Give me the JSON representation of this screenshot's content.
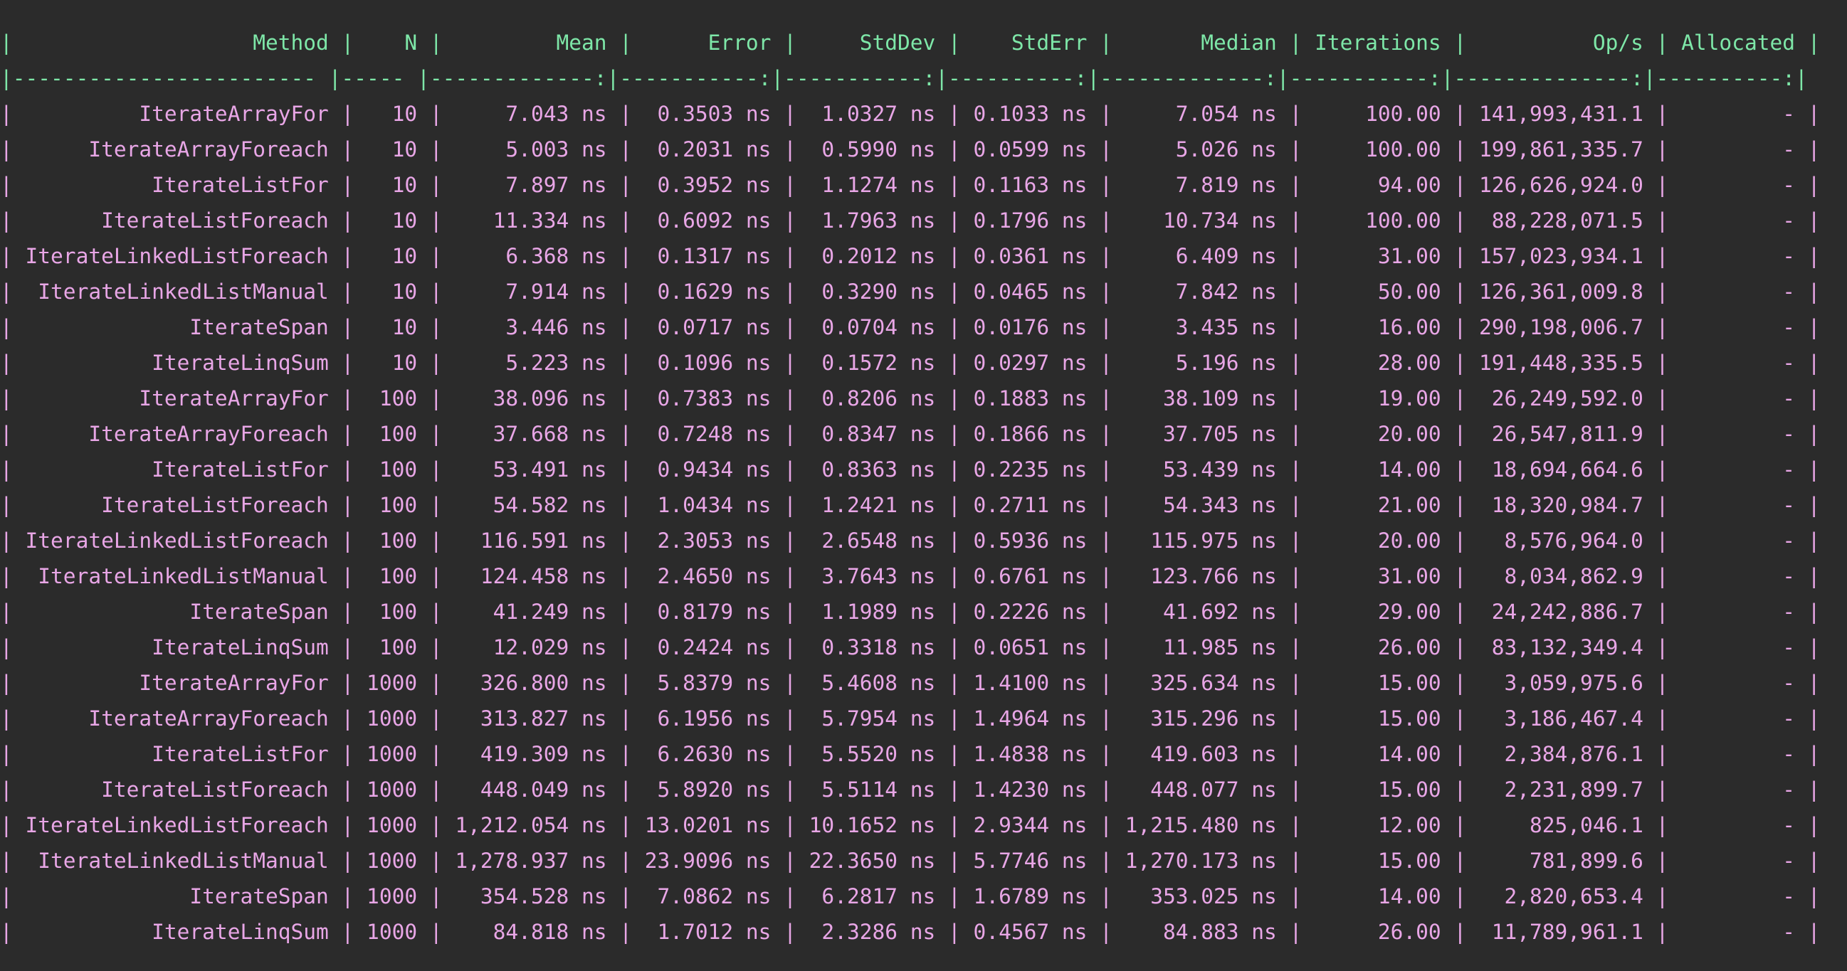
{
  "table": {
    "header": "| Method | N | Mean | Error | StdDev | StdErr | Median | Iterations | Op/s | Allocated |",
    "separator": "|------------------------ |----- |-------------:|-----------:|-----------:|----------:|-------------:|-----------:|--------------:|----------:|",
    "columns": [
      "Method",
      "N",
      "Mean",
      "Error",
      "StdDev",
      "StdErr",
      "Median",
      "Iterations",
      "Op/s",
      "Allocated"
    ],
    "rows": [
      [
        "IterateArrayFor",
        "10",
        "7.043 ns",
        "0.3503 ns",
        "1.0327 ns",
        "0.1033 ns",
        "7.054 ns",
        "100.00",
        "141,993,431.1",
        "-"
      ],
      [
        "IterateArrayForeach",
        "10",
        "5.003 ns",
        "0.2031 ns",
        "0.5990 ns",
        "0.0599 ns",
        "5.026 ns",
        "100.00",
        "199,861,335.7",
        "-"
      ],
      [
        "IterateListFor",
        "10",
        "7.897 ns",
        "0.3952 ns",
        "1.1274 ns",
        "0.1163 ns",
        "7.819 ns",
        "94.00",
        "126,626,924.0",
        "-"
      ],
      [
        "IterateListForeach",
        "10",
        "11.334 ns",
        "0.6092 ns",
        "1.7963 ns",
        "0.1796 ns",
        "10.734 ns",
        "100.00",
        "88,228,071.5",
        "-"
      ],
      [
        "IterateLinkedListForeach",
        "10",
        "6.368 ns",
        "0.1317 ns",
        "0.2012 ns",
        "0.0361 ns",
        "6.409 ns",
        "31.00",
        "157,023,934.1",
        "-"
      ],
      [
        "IterateLinkedListManual",
        "10",
        "7.914 ns",
        "0.1629 ns",
        "0.3290 ns",
        "0.0465 ns",
        "7.842 ns",
        "50.00",
        "126,361,009.8",
        "-"
      ],
      [
        "IterateSpan",
        "10",
        "3.446 ns",
        "0.0717 ns",
        "0.0704 ns",
        "0.0176 ns",
        "3.435 ns",
        "16.00",
        "290,198,006.7",
        "-"
      ],
      [
        "IterateLinqSum",
        "10",
        "5.223 ns",
        "0.1096 ns",
        "0.1572 ns",
        "0.0297 ns",
        "5.196 ns",
        "28.00",
        "191,448,335.5",
        "-"
      ],
      [
        "IterateArrayFor",
        "100",
        "38.096 ns",
        "0.7383 ns",
        "0.8206 ns",
        "0.1883 ns",
        "38.109 ns",
        "19.00",
        "26,249,592.0",
        "-"
      ],
      [
        "IterateArrayForeach",
        "100",
        "37.668 ns",
        "0.7248 ns",
        "0.8347 ns",
        "0.1866 ns",
        "37.705 ns",
        "20.00",
        "26,547,811.9",
        "-"
      ],
      [
        "IterateListFor",
        "100",
        "53.491 ns",
        "0.9434 ns",
        "0.8363 ns",
        "0.2235 ns",
        "53.439 ns",
        "14.00",
        "18,694,664.6",
        "-"
      ],
      [
        "IterateListForeach",
        "100",
        "54.582 ns",
        "1.0434 ns",
        "1.2421 ns",
        "0.2711 ns",
        "54.343 ns",
        "21.00",
        "18,320,984.7",
        "-"
      ],
      [
        "IterateLinkedListForeach",
        "100",
        "116.591 ns",
        "2.3053 ns",
        "2.6548 ns",
        "0.5936 ns",
        "115.975 ns",
        "20.00",
        "8,576,964.0",
        "-"
      ],
      [
        "IterateLinkedListManual",
        "100",
        "124.458 ns",
        "2.4650 ns",
        "3.7643 ns",
        "0.6761 ns",
        "123.766 ns",
        "31.00",
        "8,034,862.9",
        "-"
      ],
      [
        "IterateSpan",
        "100",
        "41.249 ns",
        "0.8179 ns",
        "1.1989 ns",
        "0.2226 ns",
        "41.692 ns",
        "29.00",
        "24,242,886.7",
        "-"
      ],
      [
        "IterateLinqSum",
        "100",
        "12.029 ns",
        "0.2424 ns",
        "0.3318 ns",
        "0.0651 ns",
        "11.985 ns",
        "26.00",
        "83,132,349.4",
        "-"
      ],
      [
        "IterateArrayFor",
        "1000",
        "326.800 ns",
        "5.8379 ns",
        "5.4608 ns",
        "1.4100 ns",
        "325.634 ns",
        "15.00",
        "3,059,975.6",
        "-"
      ],
      [
        "IterateArrayForeach",
        "1000",
        "313.827 ns",
        "6.1956 ns",
        "5.7954 ns",
        "1.4964 ns",
        "315.296 ns",
        "15.00",
        "3,186,467.4",
        "-"
      ],
      [
        "IterateListFor",
        "1000",
        "419.309 ns",
        "6.2630 ns",
        "5.5520 ns",
        "1.4838 ns",
        "419.603 ns",
        "14.00",
        "2,384,876.1",
        "-"
      ],
      [
        "IterateListForeach",
        "1000",
        "448.049 ns",
        "5.8920 ns",
        "5.5114 ns",
        "1.4230 ns",
        "448.077 ns",
        "15.00",
        "2,231,899.7",
        "-"
      ],
      [
        "IterateLinkedListForeach",
        "1000",
        "1,212.054 ns",
        "13.0201 ns",
        "10.1652 ns",
        "2.9344 ns",
        "1,215.480 ns",
        "12.00",
        "825,046.1",
        "-"
      ],
      [
        "IterateLinkedListManual",
        "1000",
        "1,278.937 ns",
        "23.9096 ns",
        "22.3650 ns",
        "5.7746 ns",
        "1,270.173 ns",
        "15.00",
        "781,899.6",
        "-"
      ],
      [
        "IterateSpan",
        "1000",
        "354.528 ns",
        "7.0862 ns",
        "6.2817 ns",
        "1.6789 ns",
        "353.025 ns",
        "14.00",
        "2,820,653.4",
        "-"
      ],
      [
        "IterateLinqSum",
        "1000",
        "84.818 ns",
        "1.7012 ns",
        "2.3286 ns",
        "0.4567 ns",
        "84.883 ns",
        "26.00",
        "11,789,961.1",
        "-"
      ]
    ]
  },
  "colors": {
    "background": "#2b2b2b",
    "header_text": "#7ee7a8",
    "row_text": "#e8a6e6"
  }
}
